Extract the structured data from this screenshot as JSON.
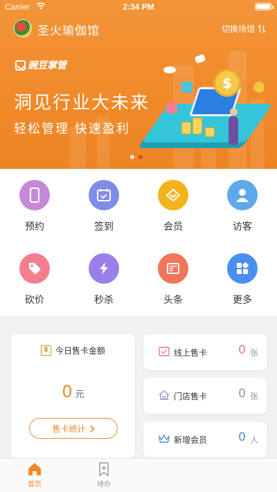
{
  "status_bar": {
    "carrier": "Carrier",
    "time": "2:34 PM"
  },
  "header": {
    "shop_name": "圣火瑜伽馆",
    "switch_label": "切换场馆",
    "switch_icon": "swap-vertical-icon"
  },
  "banner": {
    "brand": "豌豆掌管",
    "headline": "洞见行业大未来",
    "subline": "轻松管理 快速盈利",
    "page_count": 2,
    "active_page": 2
  },
  "grid": [
    {
      "label": "预约",
      "icon": "phone-icon",
      "color": "#c58ad6"
    },
    {
      "label": "签到",
      "icon": "calendar-check-icon",
      "color": "#7f8ce8"
    },
    {
      "label": "会员",
      "icon": "diamond-icon",
      "color": "#f2b31b"
    },
    {
      "label": "访客",
      "icon": "person-icon",
      "color": "#5ea9ec"
    },
    {
      "label": "砍价",
      "icon": "tag-icon",
      "color": "#f47e8f"
    },
    {
      "label": "秒杀",
      "icon": "lightning-icon",
      "color": "#9a7fe6"
    },
    {
      "label": "头条",
      "icon": "news-icon",
      "color": "#f07659"
    },
    {
      "label": "更多",
      "icon": "grid-more-icon",
      "color": "#4a8ff0"
    }
  ],
  "today_sales": {
    "title": "今日售卡金额",
    "amount": "0",
    "unit": "元",
    "button": "售卡统计"
  },
  "stats": [
    {
      "label": "线上售卡",
      "value": "0",
      "unit": "张",
      "color": "#f2768a",
      "icon": "online-card-icon"
    },
    {
      "label": "门店售卡",
      "value": "0",
      "unit": "张",
      "color": "#8f96b3",
      "icon": "store-icon"
    },
    {
      "label": "新增会员",
      "value": "0",
      "unit": "人",
      "color": "#4a90e2",
      "icon": "crown-icon"
    }
  ],
  "tabbar": [
    {
      "label": "首页",
      "icon": "home-icon",
      "active": true
    },
    {
      "label": "待办",
      "icon": "todo-bookmark-icon",
      "active": false
    }
  ],
  "colors": {
    "accent": "#f08a2a",
    "tab_active": "#f08a2a",
    "tab_inactive": "#999999"
  }
}
